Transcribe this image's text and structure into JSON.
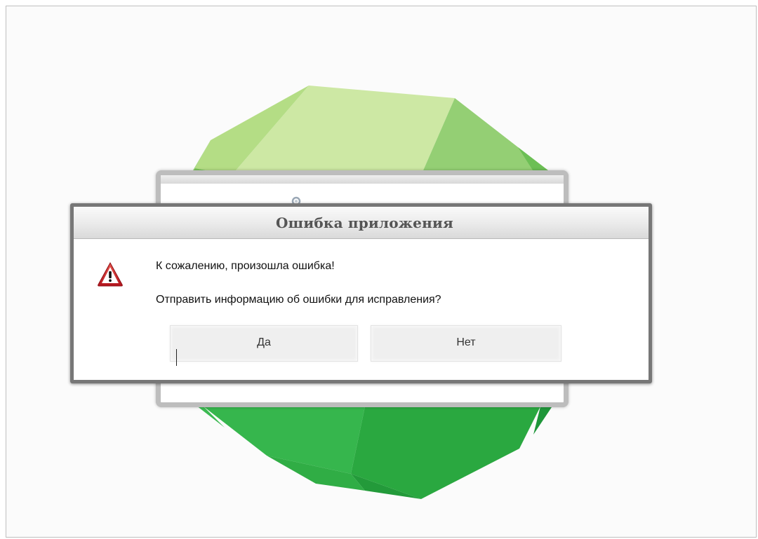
{
  "dialog": {
    "title": "Ошибка приложения",
    "message_line1": "К сожалению, произошла ошибка!",
    "message_line2": "Отправить информацию об ошибки для исправления?",
    "yes_label": "Да",
    "no_label": "Нет",
    "icon": "warning-icon"
  },
  "colors": {
    "logo_light": "#c5e59a",
    "logo_mid": "#8fcf6a",
    "logo_dark": "#2fae3f",
    "warning_red": "#d3242b",
    "dialog_border": "#777777"
  }
}
